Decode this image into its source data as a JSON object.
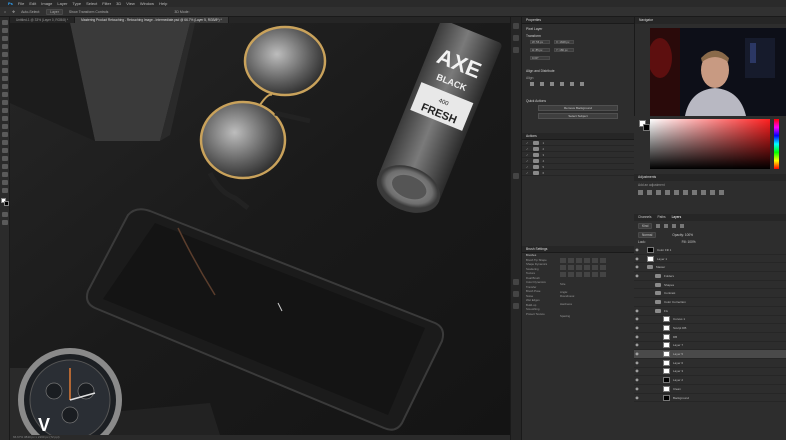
{
  "app": {
    "menu": [
      "File",
      "Edit",
      "Image",
      "Layer",
      "Type",
      "Select",
      "Filter",
      "3D",
      "View",
      "Window",
      "Help"
    ],
    "options": {
      "auto_select_label": "Auto-Select:",
      "auto_select_value": "Layer",
      "transform_controls": "Show Transform Controls",
      "mode_3d": "3D Mode:"
    }
  },
  "document_tabs": [
    {
      "label": "Untitled-1 @ 33% (Layer 0, RGB/8) *",
      "active": false
    },
    {
      "label": "Mastering Product Retouching - Retouching Image - Intermediate.psd @ 66.7% (Layer 5, RGB/8*) *",
      "active": true
    }
  ],
  "status_bar": "66.67%   3840 px x 2160 px (72 ppi)",
  "properties": {
    "title": "Properties",
    "layer_kind": "Pixel Layer",
    "transform_label": "Transform",
    "w": "W: 56 px",
    "h": "H: 85 px",
    "x": "X: 1848 px",
    "y": "Y: 186 px",
    "angle": "0.00°",
    "align_label": "Align and Distribute",
    "align_sub": "Align:",
    "quick_actions_label": "Quick Actions",
    "remove_bg": "Remove Background",
    "select_subject": "Select Subject"
  },
  "actions_panel": {
    "title": "Actions",
    "rows": [
      "1",
      "2",
      "3",
      "4",
      "5",
      "6"
    ]
  },
  "brush_settings": {
    "title": "Brush Settings",
    "brushes_label": "Brushes",
    "options": [
      "Brush Tip Shape",
      "Shape Dynamics",
      "Scattering",
      "Texture",
      "Dual Brush",
      "Color Dynamics",
      "Transfer",
      "Brush Pose",
      "Noise",
      "Wet Edges",
      "Build-up",
      "Smoothing",
      "Protect Texture"
    ],
    "size_label": "Size",
    "angle_label": "Angle:",
    "roundness_label": "Roundness:",
    "hardness_label": "Hardness",
    "spacing_label": "Spacing"
  },
  "navigator_title": "Navigator",
  "color_colors": {
    "hue_bottom": "#ff2020"
  },
  "adjustments": {
    "title": "Adjustments",
    "sub": "Add an adjustment"
  },
  "layers_panel": {
    "tabs": [
      "Channels",
      "Paths",
      "Layers"
    ],
    "kind_label": "Kind",
    "blend_mode": "Normal",
    "opacity": "Opacity: 100%",
    "lock_label": "Lock:",
    "fill": "Fill: 100%",
    "layers": [
      {
        "name": "Color Fill 1",
        "thumb": "dark",
        "eye": true
      },
      {
        "name": "Layer 1",
        "thumb": "light",
        "eye": true
      },
      {
        "name": "Master",
        "thumb": "folder",
        "eye": true
      },
      {
        "name": "Folders",
        "thumb": "folder",
        "eye": true
      },
      {
        "name": "Shapes",
        "thumb": "folder",
        "eye": false
      },
      {
        "name": "Contrast",
        "thumb": "folder",
        "eye": false
      },
      {
        "name": "Color Correction",
        "thumb": "folder",
        "eye": false
      },
      {
        "name": "Fix",
        "thumb": "folder",
        "eye": true
      },
      {
        "name": "Curves 1",
        "thumb": "light",
        "eye": true
      },
      {
        "name": "Sculpt DB",
        "thumb": "light",
        "eye": true
      },
      {
        "name": "DB",
        "thumb": "light",
        "eye": true
      },
      {
        "name": "Layer 7",
        "thumb": "light",
        "eye": true
      },
      {
        "name": "Layer 5",
        "thumb": "light",
        "eye": true
      },
      {
        "name": "Layer 6",
        "thumb": "light",
        "eye": true
      },
      {
        "name": "Layer 3",
        "thumb": "light",
        "eye": true
      },
      {
        "name": "Layer 2",
        "thumb": "dark",
        "eye": true
      },
      {
        "name": "Clean",
        "thumb": "light",
        "eye": true
      },
      {
        "name": "Background",
        "thumb": "dark",
        "eye": true
      }
    ]
  },
  "canvas": {
    "spray_brand": "AXE",
    "spray_line": "BLACK",
    "spray_scent": "FRESH",
    "spray_sub": "400"
  }
}
